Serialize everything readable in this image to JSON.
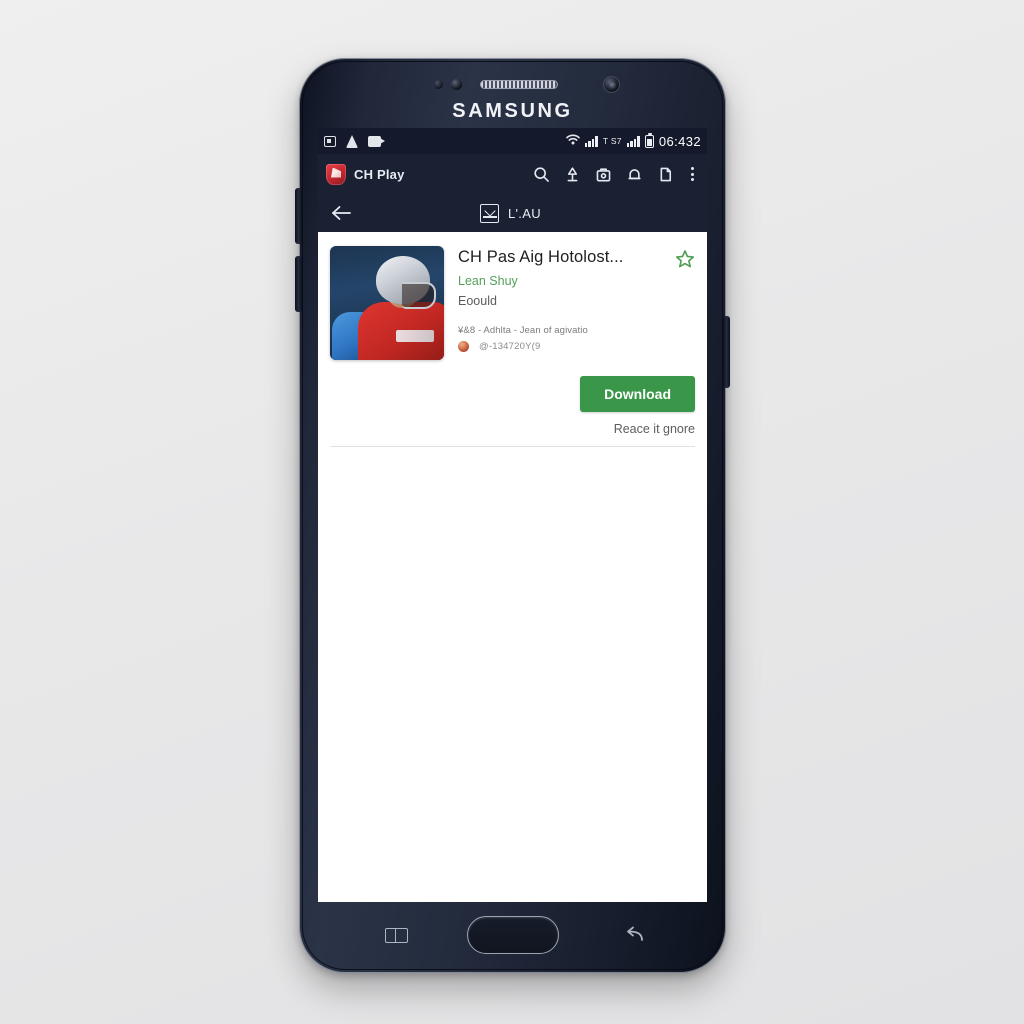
{
  "device": {
    "brand": "SAMSUNG",
    "hardware": {
      "earpiece": "earpiece-speaker",
      "front_camera": "front-camera",
      "home_button": "home-button",
      "recents_key": "recents-key",
      "back_key": "back-key",
      "volume_up": "volume-up-key",
      "volume_down": "volume-down-key",
      "power": "power-key"
    }
  },
  "status_bar": {
    "left_icons": [
      "sim-card-icon",
      "download-drop-icon",
      "screenshot-icon"
    ],
    "wifi_icon": "wifi-icon",
    "signal_icon": "signal-bars-icon",
    "carrier_text": "T S7",
    "signal_icon_2": "signal-bars-icon",
    "battery_icon": "battery-icon",
    "time": "06:432"
  },
  "app_bar": {
    "logo_icon": "ch-play-logo-icon",
    "title": "CH Play",
    "actions": [
      {
        "icon": "search-icon",
        "label": "Search"
      },
      {
        "icon": "upload-pin-icon",
        "label": "Upload"
      },
      {
        "icon": "shopping-bag-icon",
        "label": "My apps"
      },
      {
        "icon": "bell-icon",
        "label": "Notifications"
      },
      {
        "icon": "document-icon",
        "label": "Document"
      },
      {
        "icon": "overflow-menu-icon",
        "label": "More options"
      }
    ]
  },
  "sub_bar": {
    "back_icon": "back-arrow-icon",
    "inbox_icon": "download-inbox-icon",
    "label": "L'.AU"
  },
  "app_detail": {
    "thumbnail": "football-player-app-icon",
    "name": "CH Pas Aig Hotolost...",
    "developer": "Lean Shuy",
    "category": "Eoould",
    "meta_line": "¥&8 - Adhlta - Jean of agivatio",
    "meta_avatar": "reviewer-avatar",
    "meta_line_2": "@-134720Y(9",
    "wishlist_icon": "wishlist-star-icon",
    "download_label": "Download",
    "secondary_link": "Reace it gnore"
  },
  "colors": {
    "accent_green": "#3a9649",
    "developer_green": "#54a05a",
    "app_bar_navy": "#1a2133",
    "status_bar_navy": "#141a2b"
  }
}
